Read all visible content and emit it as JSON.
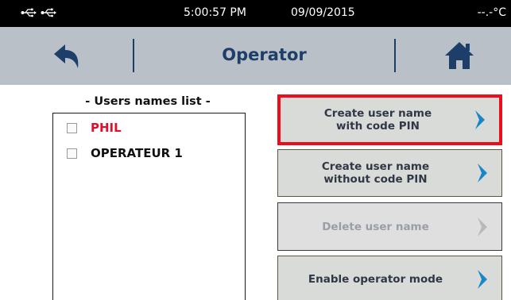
{
  "status_bar": {
    "time": "5:00:57 PM",
    "date": "09/09/2015",
    "temperature": "--.-°C",
    "icons": [
      "usb-icon",
      "usb-icon"
    ]
  },
  "header": {
    "title": "Operator",
    "back_icon": "back-arrow-icon",
    "home_icon": "home-icon",
    "accent_color": "#1d3e68"
  },
  "users": {
    "title": "- Users names list -",
    "items": [
      {
        "name": "PHIL",
        "color": "#e0102a",
        "checked": false
      },
      {
        "name": "OPERATEUR 1",
        "color": "#111111",
        "checked": false
      }
    ]
  },
  "actions": {
    "create_with_pin": {
      "line1": "Create user name",
      "line2": "with code PIN",
      "enabled": true,
      "highlighted": true
    },
    "create_without_pin": {
      "line1": "Create user name",
      "line2": "without code PIN",
      "enabled": true
    },
    "delete_user": {
      "label": "Delete user name",
      "enabled": false
    },
    "enable_operator_mode": {
      "label": "Enable operator mode",
      "enabled": true
    },
    "chevron_color": "#1a86c8",
    "highlight_color": "#ee0b1c"
  }
}
